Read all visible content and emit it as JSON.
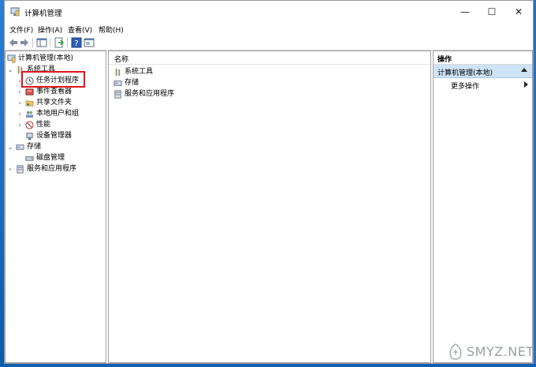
{
  "window": {
    "title": "计算机管理",
    "controls": {
      "minimize": "—",
      "maximize": "☐",
      "close": "✕"
    }
  },
  "menu": [
    "文件(F)",
    "操作(A)",
    "查看(V)",
    "帮助(H)"
  ],
  "toolbar": [
    "back-icon",
    "forward-icon",
    "show-tree-icon",
    "export-icon",
    "help-icon",
    "properties-icon"
  ],
  "tree": {
    "root": "计算机管理(本地)",
    "system_tools": "系统工具",
    "task_scheduler": "任务计划程序",
    "event_viewer": "事件查看器",
    "shared_folders": "共享文件夹",
    "local_users": "本地用户和组",
    "performance": "性能",
    "device_manager": "设备管理器",
    "storage": "存储",
    "disk_management": "磁盘管理",
    "services": "服务和应用程序"
  },
  "main": {
    "column_name": "名称",
    "items": [
      "系统工具",
      "存储",
      "服务和应用程序"
    ]
  },
  "actions": {
    "title": "操作",
    "group": "计算机管理(本地)",
    "more": "更多操作"
  },
  "watermark": "SMYZ.NET",
  "colors": {
    "selection": "#cfe3f7",
    "highlight_box": "#e0141e",
    "desktop": "#1e73c8"
  }
}
